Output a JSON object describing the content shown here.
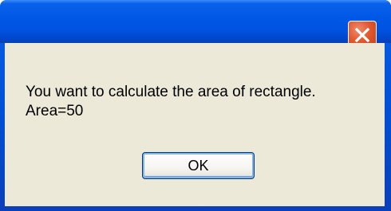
{
  "dialog": {
    "title": "",
    "message_line1": "You want to calculate the area of rectangle.",
    "message_line2": "Area=50",
    "ok_label": "OK",
    "close_icon": "close-icon"
  },
  "colors": {
    "titlebar": "#0058e6",
    "client_background": "#ece9d8",
    "close_button": "#e2582f"
  }
}
